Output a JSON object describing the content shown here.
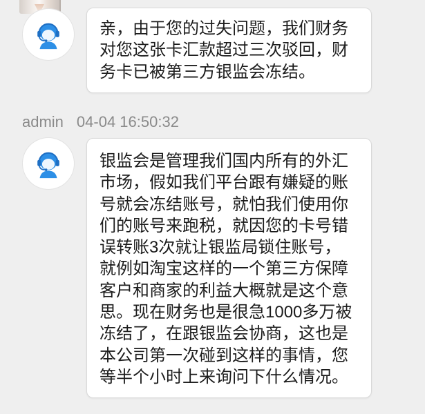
{
  "colors": {
    "background": "#efefef",
    "bubble": "#ffffff",
    "bubble_border": "#d9d9d9",
    "message_text": "#1c1c1c",
    "meta_text": "#8a8a8a",
    "avatar_icon_blue": "#2d8fe6"
  },
  "previous_avatar": {
    "icon": "user-photo-avatar"
  },
  "messages": [
    {
      "avatar_icon": "customer-service-headset-icon",
      "lines": [
        "亲，由于您的过失问题，我们财务",
        "对您这张卡汇款超过三次驳回，财",
        "务卡已被第三方银监会冻结。"
      ]
    },
    {
      "sender": "admin",
      "timestamp": "04-04 16:50:32",
      "avatar_icon": "customer-service-headset-icon",
      "lines": [
        "银监会是管理我们国内所有的外汇",
        "市场，假如我们平台跟有嫌疑的账",
        "号就会冻结账号，就怕我们使用你",
        "们的账号来跑税，就因您的卡号错",
        "误转账3次就让银监局锁住账号，",
        "就例如淘宝这样的一个第三方保障",
        "客户和商家的利益大概就是这个意",
        "思。现在财务也是很急1000多万被",
        "冻结了，在跟银监会协商，这也是",
        "本公司第一次碰到这样的事情，您",
        "等半个小时上来询问下什么情况。"
      ]
    }
  ]
}
